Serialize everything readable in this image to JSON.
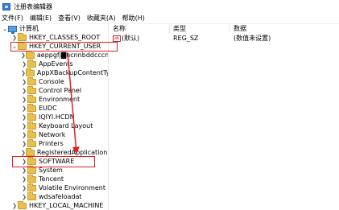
{
  "window": {
    "title": "注册表编辑器",
    "app_icon": "registry-editor-icon"
  },
  "menu": [
    "文件(F)",
    "编辑(E)",
    "查看(V)",
    "收藏夹(A)",
    "帮助(H)"
  ],
  "tree": {
    "root": "计算机",
    "hkcr": "HKEY_CLASSES_ROOT",
    "hkcu": "HKEY_CURRENT_USER",
    "children": [
      "aeppgfj▇hcnnbddcccn",
      "AppEvents",
      "AppXBackupContentTy",
      "Console",
      "Control Panel",
      "Environment",
      "EUDC",
      "IQIYI.HCDN",
      "Keyboard Layout",
      "Network",
      "Printers",
      "RegisteredApplications",
      "SOFTWARE",
      "System",
      "Tencent",
      "Volatile Environment",
      "wdsafeloadat"
    ],
    "hklm": "HKEY_LOCAL_MACHINE"
  },
  "list": {
    "headers": {
      "name": "名称",
      "type": "类型",
      "data": "数据"
    },
    "rows": [
      {
        "name": "(默认)",
        "type": "REG_SZ",
        "data": "(数值未设置)",
        "icon": "ab",
        "icon_name": "string-value-icon"
      }
    ]
  },
  "colors": {
    "highlight": "#e02020",
    "folder": "#e8c04e",
    "accent": "#3b7bd1"
  }
}
